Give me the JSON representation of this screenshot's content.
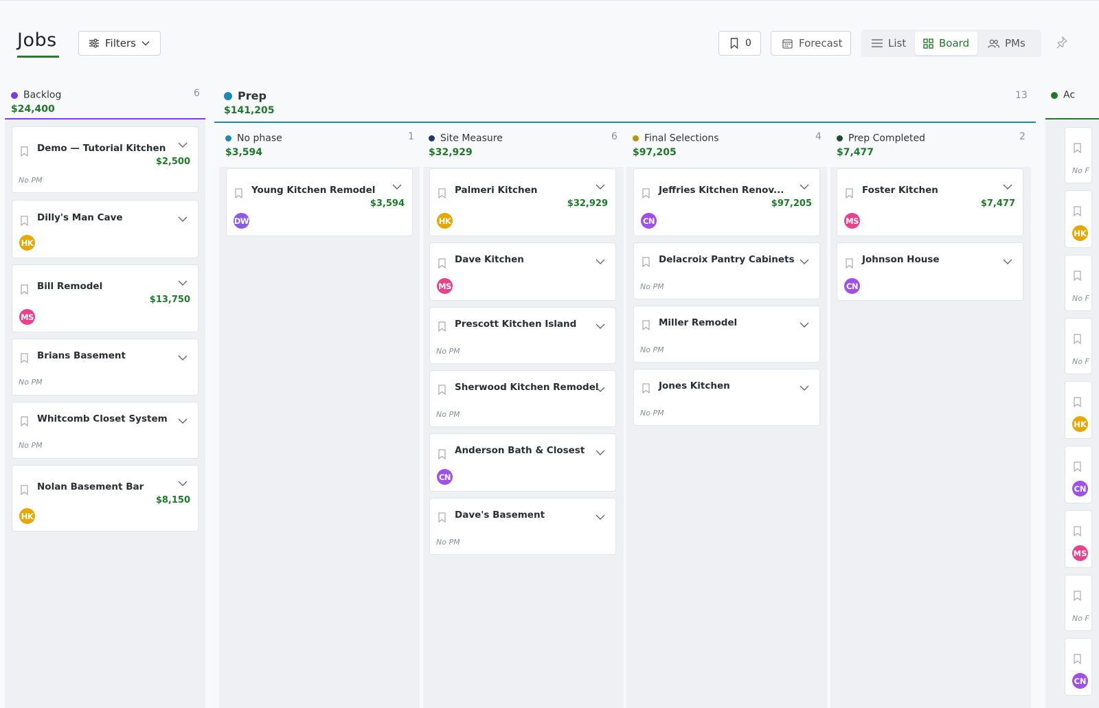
{
  "header": {
    "title": "Jobs",
    "filters_label": "Filters",
    "bookmark_count": "0",
    "forecast_label": "Forecast",
    "views": {
      "list": "List",
      "board": "Board",
      "pms": "PMs",
      "active": "board"
    }
  },
  "colors": {
    "accent": "#1d7a28",
    "backlog": "#7c3aed",
    "prep": "#1a8ab5",
    "active": "#1d7a28"
  },
  "backlog": {
    "name": "Backlog",
    "amount": "$24,400",
    "count": "6",
    "cards": [
      {
        "title": "Demo — Tutorial Kitchen",
        "amount": "$2,500",
        "pm": "No PM"
      },
      {
        "title": "Dilly's Man Cave",
        "pm_initials": "HK"
      },
      {
        "title": "Bill Remodel",
        "amount": "$13,750",
        "pm_initials": "MS"
      },
      {
        "title": "Brians Basement",
        "pm": "No PM"
      },
      {
        "title": "Whitcomb Closet System",
        "pm": "No PM"
      },
      {
        "title": "Nolan Basement Bar",
        "amount": "$8,150",
        "pm_initials": "HK"
      }
    ]
  },
  "prep": {
    "name": "Prep",
    "amount": "$141,205",
    "count": "13",
    "phases": [
      {
        "name": "No phase",
        "amount": "$3,594",
        "count": "1",
        "cards": [
          {
            "title": "Young Kitchen Remodel",
            "amount": "$3,594",
            "pm_initials": "DW"
          }
        ]
      },
      {
        "name": "Site Measure",
        "amount": "$32,929",
        "count": "6",
        "cards": [
          {
            "title": "Palmeri Kitchen",
            "amount": "$32,929",
            "pm_initials": "HK"
          },
          {
            "title": "Dave Kitchen",
            "pm_initials": "MS"
          },
          {
            "title": "Prescott Kitchen Island",
            "pm": "No PM"
          },
          {
            "title": "Sherwood Kitchen Remodel",
            "pm": "No PM"
          },
          {
            "title": "Anderson Bath & Closest",
            "pm_initials": "CN"
          },
          {
            "title": "Dave's Basement",
            "pm": "No PM"
          }
        ]
      },
      {
        "name": "Final Selections",
        "amount": "$97,205",
        "count": "4",
        "cards": [
          {
            "title": "Jeffries Kitchen Renov...",
            "amount": "$97,205",
            "pm_initials": "CN"
          },
          {
            "title": "Delacroix Pantry Cabinets",
            "pm": "No PM"
          },
          {
            "title": "Miller Remodel",
            "pm": "No PM"
          },
          {
            "title": "Jones Kitchen",
            "pm": "No PM"
          }
        ]
      },
      {
        "name": "Prep Completed",
        "amount": "$7,477",
        "count": "2",
        "cards": [
          {
            "title": "Foster Kitchen",
            "amount": "$7,477",
            "pm_initials": "MS"
          },
          {
            "title": "Johnson House",
            "pm_initials": "CN"
          }
        ]
      }
    ]
  },
  "active": {
    "name_partial": "Ac",
    "stubs": [
      {
        "pm": "No F"
      },
      {
        "pm_initials": "HK"
      },
      {
        "pm": "No F"
      },
      {
        "pm": "No F"
      },
      {
        "pm_initials": "HK"
      },
      {
        "pm_initials": "CN"
      },
      {
        "pm_initials": "MS"
      },
      {
        "pm": "No F"
      },
      {
        "pm_initials": "CN"
      }
    ]
  }
}
